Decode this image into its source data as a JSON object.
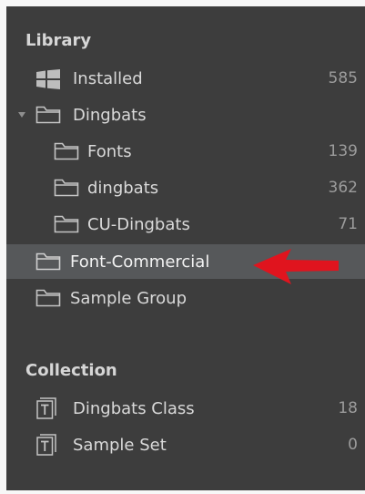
{
  "library": {
    "header": "Library",
    "items": [
      {
        "label": "Installed",
        "count": "585"
      },
      {
        "label": "Dingbats",
        "count": ""
      },
      {
        "label": "Fonts",
        "count": "139"
      },
      {
        "label": "dingbats",
        "count": "362"
      },
      {
        "label": "CU-Dingbats",
        "count": "71"
      },
      {
        "label": "Font-Commercial",
        "count": ""
      },
      {
        "label": "Sample Group",
        "count": ""
      }
    ]
  },
  "collection": {
    "header": "Collection",
    "items": [
      {
        "label": "Dingbats Class",
        "count": "18"
      },
      {
        "label": "Sample Set",
        "count": "0"
      }
    ]
  },
  "colors": {
    "panel_bg": "#3d3d3d",
    "selected_bg": "#56585a",
    "text": "#d9d9d9",
    "count_text": "#9c9c9c",
    "annotation_arrow": "#e0141e"
  },
  "icons": {
    "installed": "windows-icon",
    "group": "folder-icon",
    "collection": "font-collection-icon",
    "annotation": "red-arrow-icon"
  }
}
